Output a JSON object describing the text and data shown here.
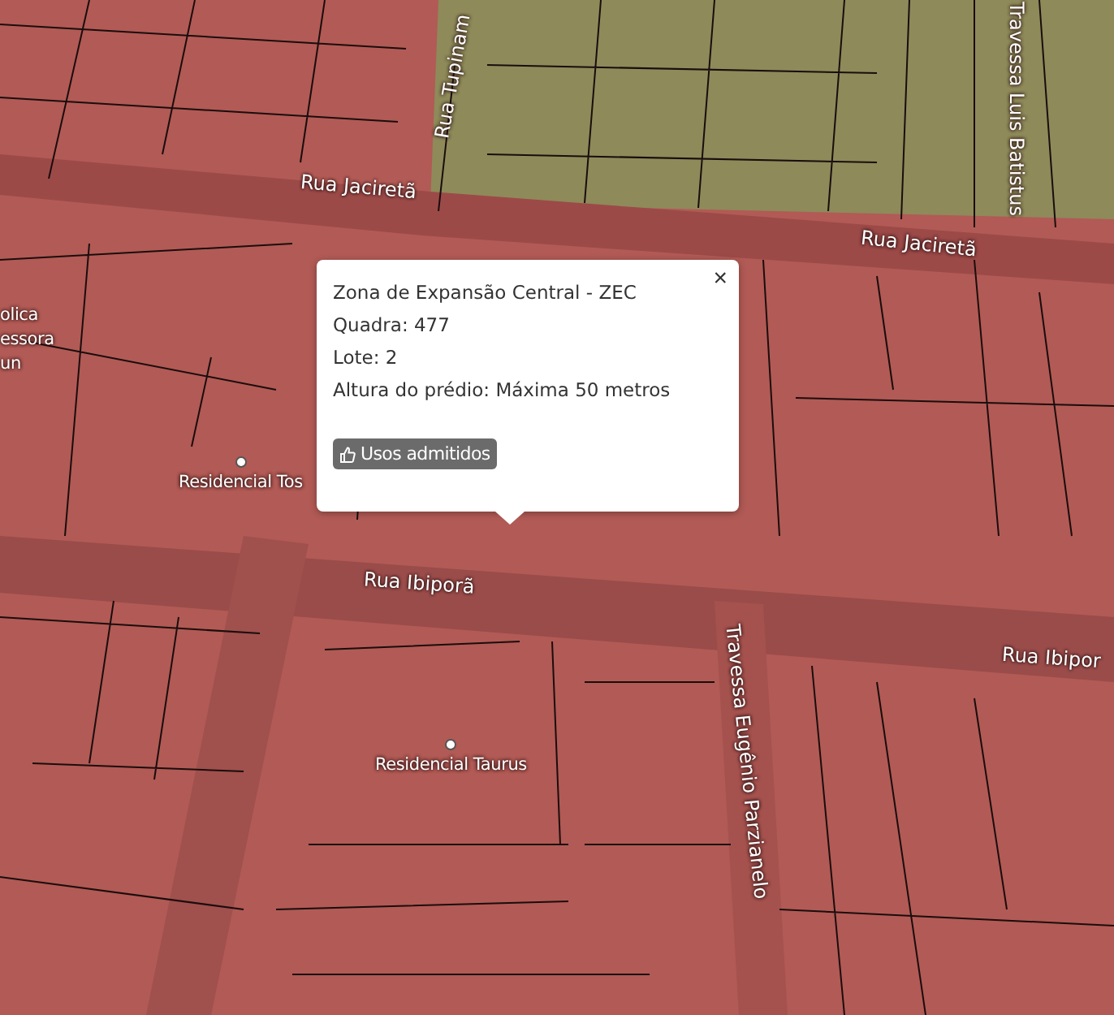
{
  "map": {
    "labels": [
      {
        "kind": "street",
        "text": "Rua Tupinam"
      },
      {
        "kind": "street",
        "text": "Travessa Luis Batistus"
      },
      {
        "kind": "street",
        "text": "Rua Jaciretã"
      },
      {
        "kind": "street",
        "text": "Rua Jaciretã"
      },
      {
        "kind": "place",
        "text": "olica"
      },
      {
        "kind": "place",
        "text": "essora"
      },
      {
        "kind": "place",
        "text": "un"
      },
      {
        "kind": "place",
        "text": "Residencial Tos",
        "marker": true
      },
      {
        "kind": "street",
        "text": "Rua Ibiporã"
      },
      {
        "kind": "street",
        "text": "Travessa Eugênio Parzianelo"
      },
      {
        "kind": "street",
        "text": "Rua Ibipor"
      },
      {
        "kind": "place",
        "text": "Residencial Taurus",
        "marker": true
      }
    ]
  },
  "popup": {
    "close": "×",
    "lines": [
      "Zona de Expansão Central - ZEC",
      "Quadra: 477",
      "Lote: 2",
      "Altura do prédio: Máxima 50 metros"
    ],
    "button": "Usos admitidos"
  }
}
